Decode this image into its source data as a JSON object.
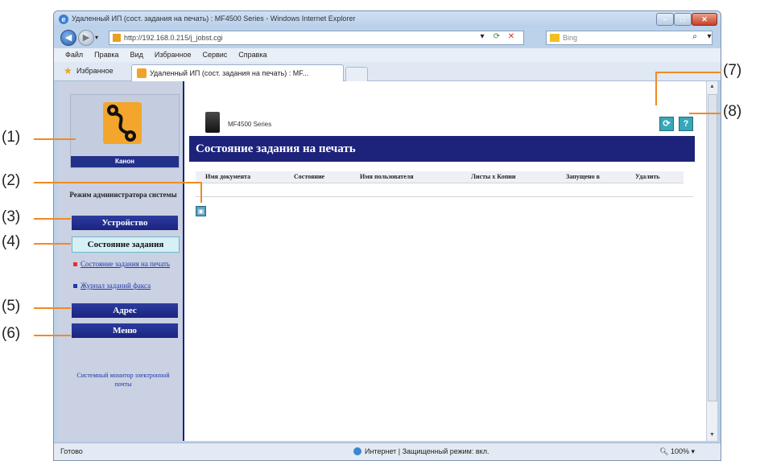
{
  "browser": {
    "title": "Удаленный ИП (сост. задания на печать) : MF4500 Series - Windows Internet Explorer",
    "address": "http://192.168.0.215/j_jobst.cgi",
    "search_placeholder": "Bing",
    "menu": [
      "Файл",
      "Правка",
      "Вид",
      "Избранное",
      "Сервис",
      "Справка"
    ],
    "favorites_label": "Избранное",
    "tab_title": "Удаленный ИП (сост. задания на печать) : MF..."
  },
  "sidebar": {
    "logo_caption": "Канон",
    "admin_mode": "Режим администратора системы",
    "device_btn": "Устройство",
    "job_status_btn": "Состояние задания",
    "sublinks": [
      "Состояние задания на печать",
      "Журнал заданий факса"
    ],
    "address_btn": "Адрес",
    "menu_btn": "Меню",
    "footer_link": "Системный монитор электронной почты"
  },
  "main": {
    "model": "MF4500 Series",
    "page_title": "Состояние задания на печать",
    "columns": [
      "Имя документа",
      "Состояние",
      "Имя пользователя",
      "Листы х Копии",
      "Запущено в",
      "Удалить"
    ]
  },
  "status": {
    "left": "Готово",
    "zone": "Интернет | Защищенный режим: вкл.",
    "zoom": "100%"
  },
  "callouts": [
    "(1)",
    "(2)",
    "(3)",
    "(4)",
    "(5)",
    "(6)",
    "(7)",
    "(8)"
  ],
  "colors": {
    "accent": "#1d237a",
    "callout_line": "#f08a24",
    "active_button": "#d6f0f6"
  }
}
